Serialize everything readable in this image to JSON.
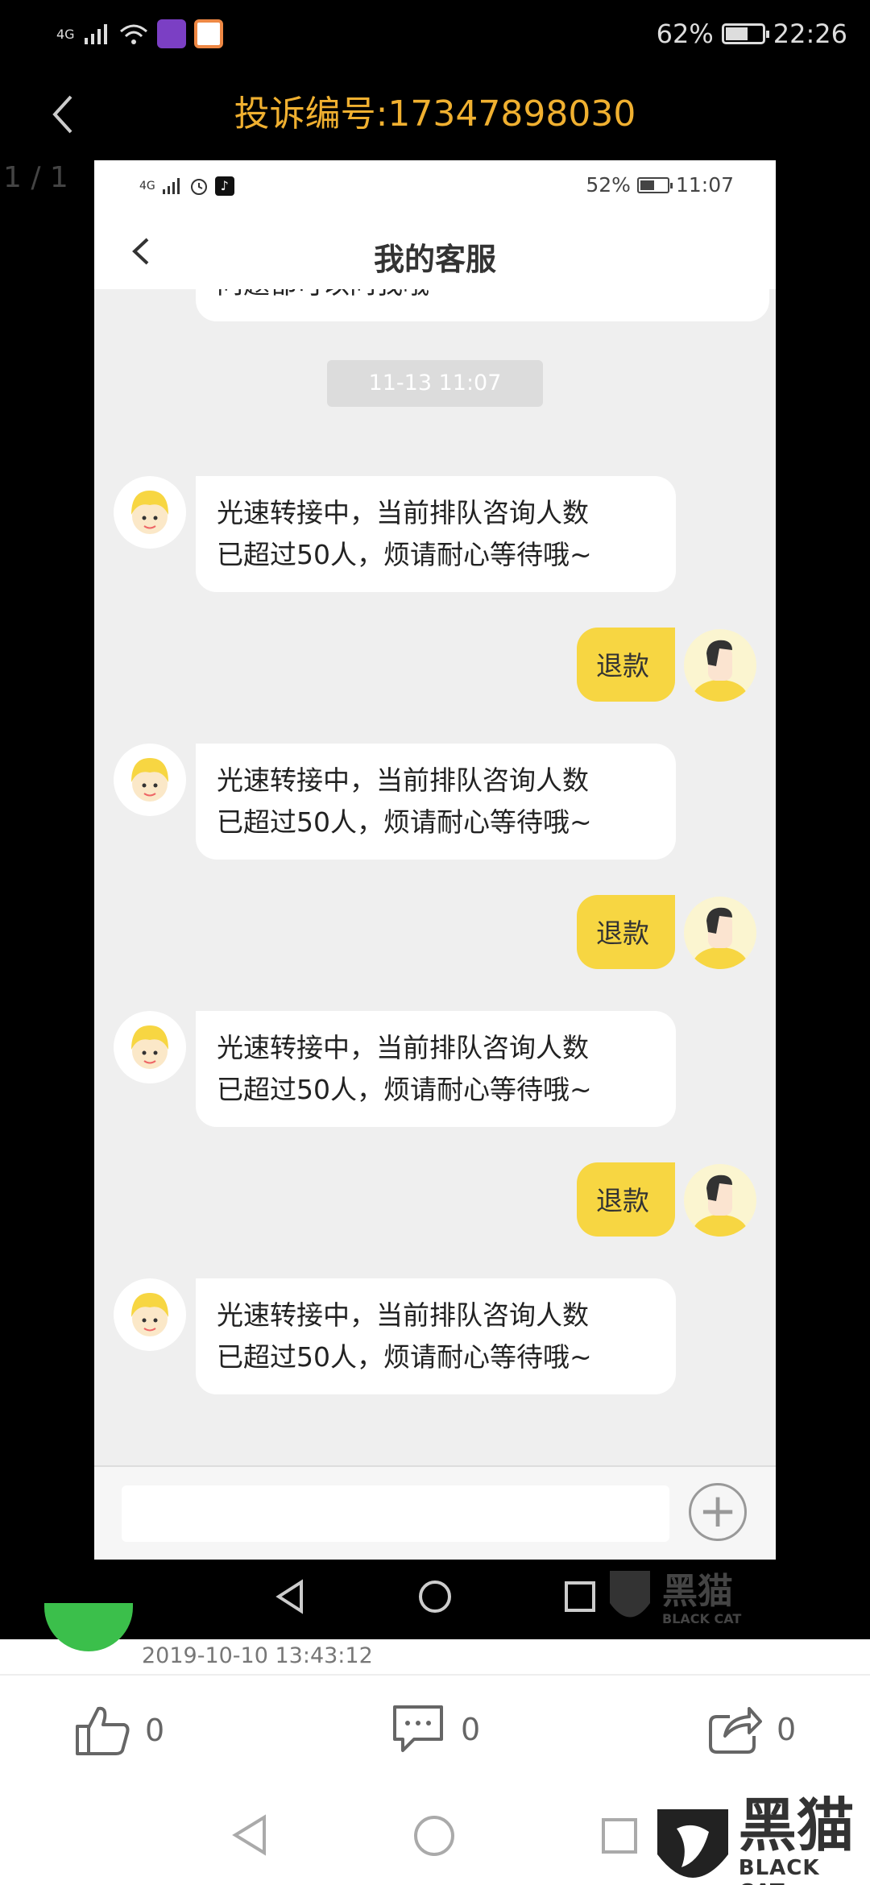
{
  "status_bar": {
    "network": "4G",
    "battery": "62%",
    "battery_level": 0.62,
    "time": "22:26"
  },
  "viewer": {
    "title": "投诉编号:17347898030",
    "page_counter": "1 / 1"
  },
  "inner": {
    "status_bar": {
      "network": "4G",
      "battery": "52%",
      "battery_level": 0.52,
      "time": "11:07"
    },
    "title": "我的客服",
    "partial_text": "问题都可以问我哦~",
    "timestamp": "11-13 11:07",
    "messages": [
      {
        "from": "agent",
        "line1": "光速转接中，当前排队咨询人数",
        "line2": "已超过50人，烦请耐心等待哦~"
      },
      {
        "from": "user",
        "text": "退款"
      },
      {
        "from": "agent",
        "line1": "光速转接中，当前排队咨询人数",
        "line2": "已超过50人，烦请耐心等待哦~"
      },
      {
        "from": "user",
        "text": "退款"
      },
      {
        "from": "agent",
        "line1": "光速转接中，当前排队咨询人数",
        "line2": "已超过50人，烦请耐心等待哦~"
      },
      {
        "from": "user",
        "text": "退款"
      },
      {
        "from": "agent",
        "line1": "光速转接中，当前排队咨询人数",
        "line2": "已超过50人，烦请耐心等待哦~"
      }
    ],
    "input_placeholder": ""
  },
  "post": {
    "date": "2019-10-10 13:43:12",
    "likes": "0",
    "comments": "0",
    "shares": "0"
  },
  "watermark": {
    "cn": "黑猫",
    "en": "BLACK CAT"
  },
  "colors": {
    "accent": "#f0b030",
    "bubble_user": "#f7d642",
    "green": "#3bbf4b"
  }
}
